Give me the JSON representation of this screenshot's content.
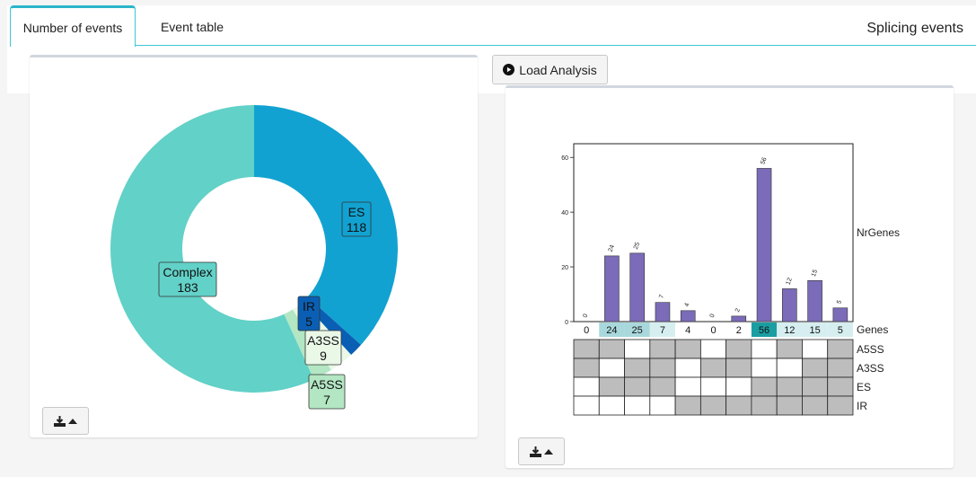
{
  "tabs": [
    {
      "label": "Number of events",
      "active": true
    },
    {
      "label": "Event table",
      "active": false
    }
  ],
  "page_title": "Splicing events",
  "load_button_label": "Load Analysis",
  "donut": {
    "segments": [
      {
        "name": "ES",
        "value": 118,
        "color": "#12a2d1"
      },
      {
        "name": "IR",
        "value": 5,
        "color": "#0a5fb4"
      },
      {
        "name": "A3SS",
        "value": 9,
        "color": "#e9f8e7"
      },
      {
        "name": "A5SS",
        "value": 7,
        "color": "#b3e6c3"
      },
      {
        "name": "Complex",
        "value": 183,
        "color": "#62d1c7"
      }
    ]
  },
  "chart_data": {
    "type": "bar",
    "ylabel": "NrGenes",
    "ylim": [
      0,
      65
    ],
    "yticks": [
      0,
      20,
      40,
      60
    ],
    "values": [
      0,
      24,
      25,
      7,
      4,
      0,
      2,
      56,
      12,
      15,
      5
    ],
    "value_labels": [
      "0",
      "24",
      "25",
      "7",
      "4",
      "0",
      "2",
      "56",
      "12",
      "15",
      "5"
    ],
    "genes_label": "Genes",
    "gene_counts": [
      "0",
      "24",
      "25",
      "7",
      "4",
      "0",
      "2",
      "56",
      "12",
      "15",
      "5"
    ],
    "rows": [
      {
        "name": "A5SS",
        "cells": [
          1,
          1,
          0,
          1,
          1,
          0,
          1,
          0,
          1,
          0,
          1
        ]
      },
      {
        "name": "A3SS",
        "cells": [
          1,
          0,
          1,
          1,
          0,
          1,
          1,
          0,
          0,
          1,
          1
        ]
      },
      {
        "name": "ES",
        "cells": [
          0,
          1,
          1,
          1,
          0,
          0,
          0,
          1,
          1,
          1,
          1
        ]
      },
      {
        "name": "IR",
        "cells": [
          0,
          0,
          0,
          0,
          1,
          1,
          1,
          1,
          1,
          1,
          1
        ]
      }
    ],
    "bar_color": "#7b6bb8",
    "cell_on_color": "#bdbdbd"
  }
}
